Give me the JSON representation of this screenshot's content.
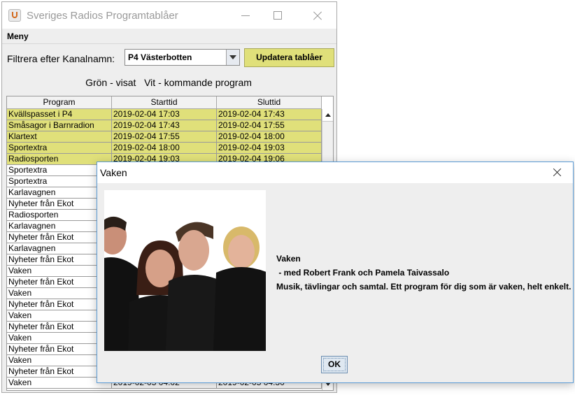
{
  "window": {
    "title": "Sveriges Radios Programtablåer"
  },
  "menu": {
    "items": [
      "Meny"
    ]
  },
  "filter": {
    "label": "Filtrera efter Kanalnamn:",
    "selected_channel": "P4 Västerbotten",
    "update_button": "Updatera tablåer"
  },
  "legend": "Grön - visat   Vit - kommande program",
  "colors": {
    "shown_row": "#e0e07a",
    "upcoming_row": "#ffffff"
  },
  "table": {
    "headers": [
      "Program",
      "Starttid",
      "Sluttid"
    ],
    "rows": [
      {
        "program": "Kvällspasset i P4",
        "start": "2019-02-04  17:03",
        "end": "2019-02-04  17:43",
        "shown": true
      },
      {
        "program": "Småsagor i Barnradion",
        "start": "2019-02-04  17:43",
        "end": "2019-02-04  17:55",
        "shown": true
      },
      {
        "program": "Klartext",
        "start": "2019-02-04  17:55",
        "end": "2019-02-04  18:00",
        "shown": true
      },
      {
        "program": "Sportextra",
        "start": "2019-02-04  18:00",
        "end": "2019-02-04  19:03",
        "shown": true
      },
      {
        "program": "Radiosporten",
        "start": "2019-02-04  19:03",
        "end": "2019-02-04  19:06",
        "shown": true
      },
      {
        "program": "Sportextra",
        "start": "",
        "end": "",
        "shown": false
      },
      {
        "program": "Sportextra",
        "start": "",
        "end": "",
        "shown": false
      },
      {
        "program": "Karlavagnen",
        "start": "",
        "end": "",
        "shown": false
      },
      {
        "program": "Nyheter från Ekot",
        "start": "",
        "end": "",
        "shown": false
      },
      {
        "program": "Radiosporten",
        "start": "",
        "end": "",
        "shown": false
      },
      {
        "program": "Karlavagnen",
        "start": "",
        "end": "",
        "shown": false
      },
      {
        "program": "Nyheter från Ekot",
        "start": "",
        "end": "",
        "shown": false
      },
      {
        "program": "Karlavagnen",
        "start": "",
        "end": "",
        "shown": false
      },
      {
        "program": "Nyheter från Ekot",
        "start": "",
        "end": "",
        "shown": false
      },
      {
        "program": "Vaken",
        "start": "",
        "end": "",
        "shown": false
      },
      {
        "program": "Nyheter från Ekot",
        "start": "",
        "end": "",
        "shown": false
      },
      {
        "program": "Vaken",
        "start": "",
        "end": "",
        "shown": false
      },
      {
        "program": "Nyheter från Ekot",
        "start": "",
        "end": "",
        "shown": false
      },
      {
        "program": "Vaken",
        "start": "",
        "end": "",
        "shown": false
      },
      {
        "program": "Nyheter från Ekot",
        "start": "",
        "end": "",
        "shown": false
      },
      {
        "program": "Vaken",
        "start": "",
        "end": "",
        "shown": false
      },
      {
        "program": "Nyheter från Ekot",
        "start": "",
        "end": "",
        "shown": false
      },
      {
        "program": "Vaken",
        "start": "",
        "end": "",
        "shown": false
      },
      {
        "program": "Nyheter från Ekot",
        "start": "",
        "end": "",
        "shown": false
      },
      {
        "program": "Vaken",
        "start": "2019-02-05  04:02",
        "end": "2019-02-05  04:30",
        "shown": false
      }
    ]
  },
  "dialog": {
    "title": "Vaken",
    "program_name": "Vaken",
    "hosts": " - med Robert Frank och Pamela Taivassalo",
    "description": "Musik, tävlingar och samtal. Ett program för dig som är vaken, helt enkelt.",
    "ok_button": "OK"
  }
}
